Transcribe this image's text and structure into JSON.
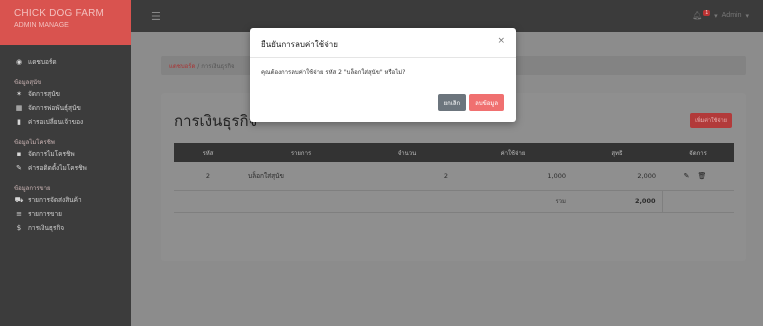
{
  "brand": {
    "line1": "CHICK DOG FARM",
    "line2": "ADMIN MANAGE"
  },
  "topbar": {
    "hamburger_icon": "menu-icon",
    "notif_count": "1",
    "user": "Admin"
  },
  "sidebar": {
    "dashboard": "แดชบอร์ด",
    "section_dogs": "ข้อมูลสุนัข",
    "item_dogs": "จัดการสุนัข",
    "item_breed": "จัดการพ่อพันธุ์สุนัข",
    "item_owner": "ค่ารอเปลี่ยนเจ้าของ",
    "section_micro": "ข้อมูลไมโครชิพ",
    "item_micro": "จัดการไมโครชิพ",
    "item_micro_use": "ค่ารอติดตั้งไมโครชิพ",
    "section_finance": "ข้อมูลการขาย",
    "item_expense": "รายการจัดส่งสินค้า",
    "item_sales": "รายการขาย",
    "item_finance": "การเงินธุรกิจ"
  },
  "breadcrumb": {
    "home": "แดชบอร์ด",
    "current": "การเงินธุรกิจ"
  },
  "page": {
    "title": "การเงินธุรกิจ",
    "add_button": "เพิ่มค่าใช้จ่าย"
  },
  "table": {
    "headers": [
      "รหัส",
      "รายการ",
      "จำนวน",
      "ค่าใช้จ่าย",
      "สุทธิ",
      "จัดการ"
    ],
    "rows": [
      {
        "id": "2",
        "item": "บล็อกใส่สุนัข",
        "qty": "2",
        "cost": "1,000",
        "net": "2,000"
      }
    ],
    "total_label": "รวม",
    "total_value": "2,000"
  },
  "modal": {
    "title": "ยืนยันการลบค่าใช้จ่าย",
    "close": "×",
    "message": "คุณต้องการลบค่าใช้จ่าย รหัส 2 \"บล็อกใส่สุนัข\" หรือไม่?",
    "cancel": "ยกเลิก",
    "confirm": "ลบข้อมูล"
  }
}
